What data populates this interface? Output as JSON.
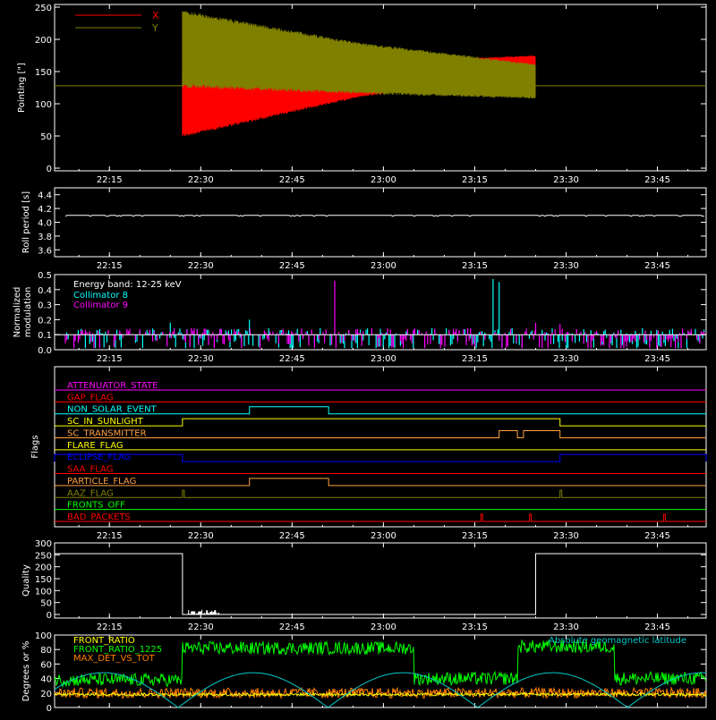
{
  "x_ticks": [
    "22:15",
    "22:30",
    "22:45",
    "23:00",
    "23:15",
    "23:30",
    "23:45"
  ],
  "x_range": [
    "22:06",
    "23:53"
  ],
  "chart_data": [
    {
      "type": "line",
      "ylabel": "Pointing [\"]",
      "ylim": [
        0,
        250
      ],
      "yticks": [
        "0",
        "50",
        "100",
        "150",
        "200",
        "250"
      ],
      "reference_line": 128,
      "data_window": [
        "22:27",
        "23:25"
      ],
      "series": [
        {
          "name": "X",
          "color": "#ff0000",
          "envelope_lower": [
            [
              0,
              48
            ],
            [
              0.5,
              110
            ],
            [
              1,
              145
            ]
          ],
          "envelope_upper": [
            [
              0,
              148
            ],
            [
              0.5,
              165
            ],
            [
              1,
              175
            ]
          ]
        },
        {
          "name": "Y",
          "color": "#808000",
          "envelope_lower": [
            [
              0,
              125
            ],
            [
              0.5,
              115
            ],
            [
              1,
              108
            ]
          ],
          "envelope_upper": [
            [
              0,
              245
            ],
            [
              0.5,
              195
            ],
            [
              1,
              162
            ]
          ]
        }
      ],
      "legend_position": "top-left"
    },
    {
      "type": "line",
      "ylabel": "Roll period [s]",
      "ylim": [
        3.5,
        4.5
      ],
      "yticks": [
        "3.6",
        "3.8",
        "4.0",
        "4.2",
        "4.4"
      ],
      "series": [
        {
          "name": "",
          "color": "#ffffff",
          "value": 4.1
        }
      ]
    },
    {
      "type": "bar",
      "ylabel": "Normalized modulation",
      "ylim": [
        0,
        0.5
      ],
      "yticks": [
        "0.0",
        "0.1",
        "0.2",
        "0.3",
        "0.4",
        "0.5"
      ],
      "baseline": 0.1,
      "legend_title": "Energy band: 12-25 keV",
      "series": [
        {
          "name": "Collimator 8",
          "color": "#00ffff",
          "spikes": [
            {
              "t": "23:18",
              "v": 0.47
            },
            {
              "t": "23:19",
              "v": 0.45
            },
            {
              "t": "22:25",
              "v": 0.18
            },
            {
              "t": "22:38",
              "v": 0.2
            }
          ]
        },
        {
          "name": "Collimator 9",
          "color": "#ff00ff",
          "spikes": [
            {
              "t": "22:52",
              "v": 0.46
            },
            {
              "t": "23:25",
              "v": 0.18
            },
            {
              "t": "23:29",
              "v": 0.17
            }
          ]
        }
      ]
    },
    {
      "type": "line",
      "ylabel": "Flags",
      "flags": [
        {
          "name": "ATTENUATOR_STATE",
          "color": "#ff00ff",
          "segments": []
        },
        {
          "name": "GAP_FLAG",
          "color": "#ff0000",
          "segments": []
        },
        {
          "name": "NON_SOLAR_EVENT",
          "color": "#00ffff",
          "segments": [
            [
              "22:38",
              "22:51"
            ]
          ]
        },
        {
          "name": "SC_IN_SUNLIGHT",
          "color": "#ffff00",
          "segments": [
            [
              "22:27",
              "23:29"
            ]
          ]
        },
        {
          "name": "SC_TRANSMITTER",
          "color": "#ffa040",
          "segments": [
            [
              "23:19",
              "23:22"
            ],
            [
              "23:23",
              "23:29"
            ]
          ]
        },
        {
          "name": "FLARE_FLAG",
          "color": "#ffff00",
          "segments": []
        },
        {
          "name": "ECLIPSE_FLAG",
          "color": "#0000ff",
          "segments": [
            [
              "22:06",
              "22:27"
            ],
            [
              "23:29",
              "23:53"
            ]
          ]
        },
        {
          "name": "SAA_FLAG",
          "color": "#ff0000",
          "segments": []
        },
        {
          "name": "PARTICLE_FLAG",
          "color": "#ffa040",
          "segments": [
            [
              "22:38",
              "22:51"
            ]
          ]
        },
        {
          "name": "AAZ_FLAG",
          "color": "#808000",
          "segments": [
            [
              "22:27",
              "22:27"
            ],
            [
              "23:29",
              "23:29"
            ]
          ]
        },
        {
          "name": "FRONTS_OFF",
          "color": "#00ff00",
          "segments": []
        },
        {
          "name": "BAD_PACKETS",
          "color": "#ff0000",
          "segments": [
            [
              "23:16",
              "23:16"
            ],
            [
              "23:24",
              "23:24"
            ],
            [
              "23:46",
              "23:46"
            ]
          ]
        }
      ]
    },
    {
      "type": "line",
      "ylabel": "Quality",
      "ylim": [
        0,
        300
      ],
      "yticks": [
        "0",
        "50",
        "100",
        "150",
        "200",
        "250",
        "300"
      ],
      "series": [
        {
          "name": "",
          "color": "#ffffff",
          "points": [
            [
              "22:06",
              255
            ],
            [
              "22:27",
              255
            ],
            [
              "22:27",
              0
            ],
            [
              "23:25",
              0
            ],
            [
              "23:25",
              255
            ],
            [
              "23:53",
              255
            ]
          ],
          "noise_window": [
            "22:28",
            "22:33"
          ],
          "noise_max": 20
        }
      ]
    },
    {
      "type": "line",
      "ylabel": "Degrees or %",
      "ylim": [
        0,
        100
      ],
      "yticks": [
        "0",
        "20",
        "40",
        "60",
        "80",
        "100"
      ],
      "series": [
        {
          "name": "FRONT_RATIO",
          "color": "#ffff00",
          "level": 18
        },
        {
          "name": "FRONT_RATIO_1225",
          "color": "#00ff00",
          "levels": [
            {
              "from": "22:06",
              "to": "22:27",
              "value": 38
            },
            {
              "from": "22:27",
              "to": "23:05",
              "value": 82
            },
            {
              "from": "23:05",
              "to": "23:22",
              "value": 40
            },
            {
              "from": "23:22",
              "to": "23:38",
              "value": 84
            },
            {
              "from": "23:38",
              "to": "23:53",
              "value": 40
            }
          ]
        },
        {
          "name": "MAX_DET_VS_TOT",
          "color": "#ff8000",
          "level": 20
        },
        {
          "name": "Absolute geomagnetic latitude",
          "color": "#00c8c8",
          "amplitude": 48
        }
      ]
    }
  ]
}
